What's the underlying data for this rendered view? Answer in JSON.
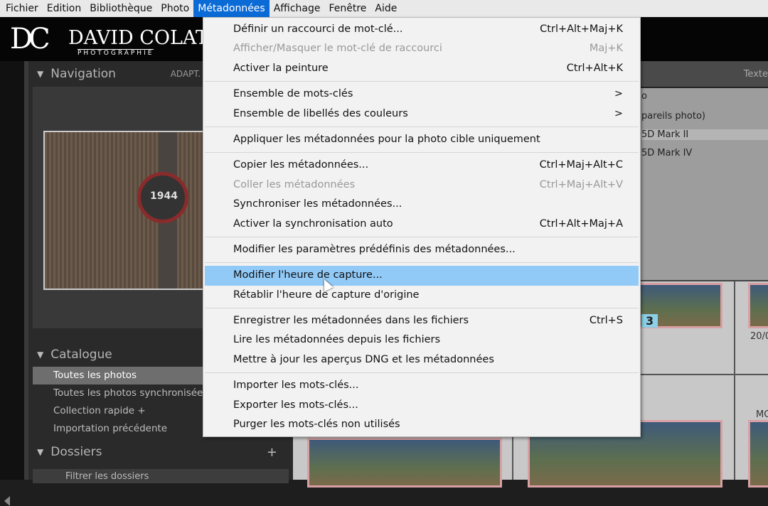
{
  "menubar": [
    "Fichier",
    "Edition",
    "Bibliothèque",
    "Photo",
    "Métadonnées",
    "Affichage",
    "Fenêtre",
    "Aide"
  ],
  "logo": {
    "initials": "DC",
    "name": "DAVID COLAT",
    "sub": "PHOTOGRAPHIE"
  },
  "left": {
    "navigation": "Navigation",
    "adapt": "ADAPT. ⇕",
    "watch_time": "1944",
    "catalogue": "Catalogue",
    "catalogue_items": [
      "Toutes les photos",
      "Toutes les photos synchronisées",
      "Collection rapide +",
      "Importation précédente"
    ],
    "dossiers": "Dossiers",
    "plus": "+",
    "filter": "Filtrer les dossiers"
  },
  "right": {
    "texte": "Texte",
    "meta_rows": [
      "o",
      "pareils photo)",
      "5D Mark II",
      "5D Mark IV"
    ],
    "date": "20/0",
    "mo": "MO",
    "badge": "3"
  },
  "menu": {
    "items": [
      {
        "label": "Définir un raccourci de mot-clé...",
        "shortcut": "Ctrl+Alt+Maj+K"
      },
      {
        "label": "Afficher/Masquer le mot-clé de raccourci",
        "shortcut": "Maj+K",
        "disabled": true
      },
      {
        "label": "Activer la peinture",
        "shortcut": "Ctrl+Alt+K"
      },
      {
        "label": "Ensemble de mots-clés",
        "shortcut": ">"
      },
      {
        "label": "Ensemble de libellés des couleurs",
        "shortcut": ">"
      },
      {
        "label": "Appliquer les métadonnées pour la photo cible uniquement",
        "shortcut": ""
      },
      {
        "label": "Copier les métadonnées...",
        "shortcut": "Ctrl+Maj+Alt+C"
      },
      {
        "label": "Coller les métadonnées",
        "shortcut": "Ctrl+Maj+Alt+V",
        "disabled": true
      },
      {
        "label": "Synchroniser les métadonnées...",
        "shortcut": ""
      },
      {
        "label": "Activer la synchronisation auto",
        "shortcut": "Ctrl+Alt+Maj+A"
      },
      {
        "label": "Modifier les paramètres prédéfinis des métadonnées...",
        "shortcut": ""
      },
      {
        "label": "Modifier l'heure de capture...",
        "shortcut": "",
        "highlighted": true
      },
      {
        "label": "Rétablir l'heure de capture d'origine",
        "shortcut": ""
      },
      {
        "label": "Enregistrer les métadonnées dans les fichiers",
        "shortcut": "Ctrl+S"
      },
      {
        "label": "Lire les métadonnées depuis les fichiers",
        "shortcut": ""
      },
      {
        "label": "Mettre à jour les aperçus DNG et les métadonnées",
        "shortcut": ""
      },
      {
        "label": "Importer les mots-clés...",
        "shortcut": ""
      },
      {
        "label": "Exporter les mots-clés...",
        "shortcut": ""
      },
      {
        "label": "Purger les mots-clés non utilisés",
        "shortcut": ""
      }
    ]
  }
}
